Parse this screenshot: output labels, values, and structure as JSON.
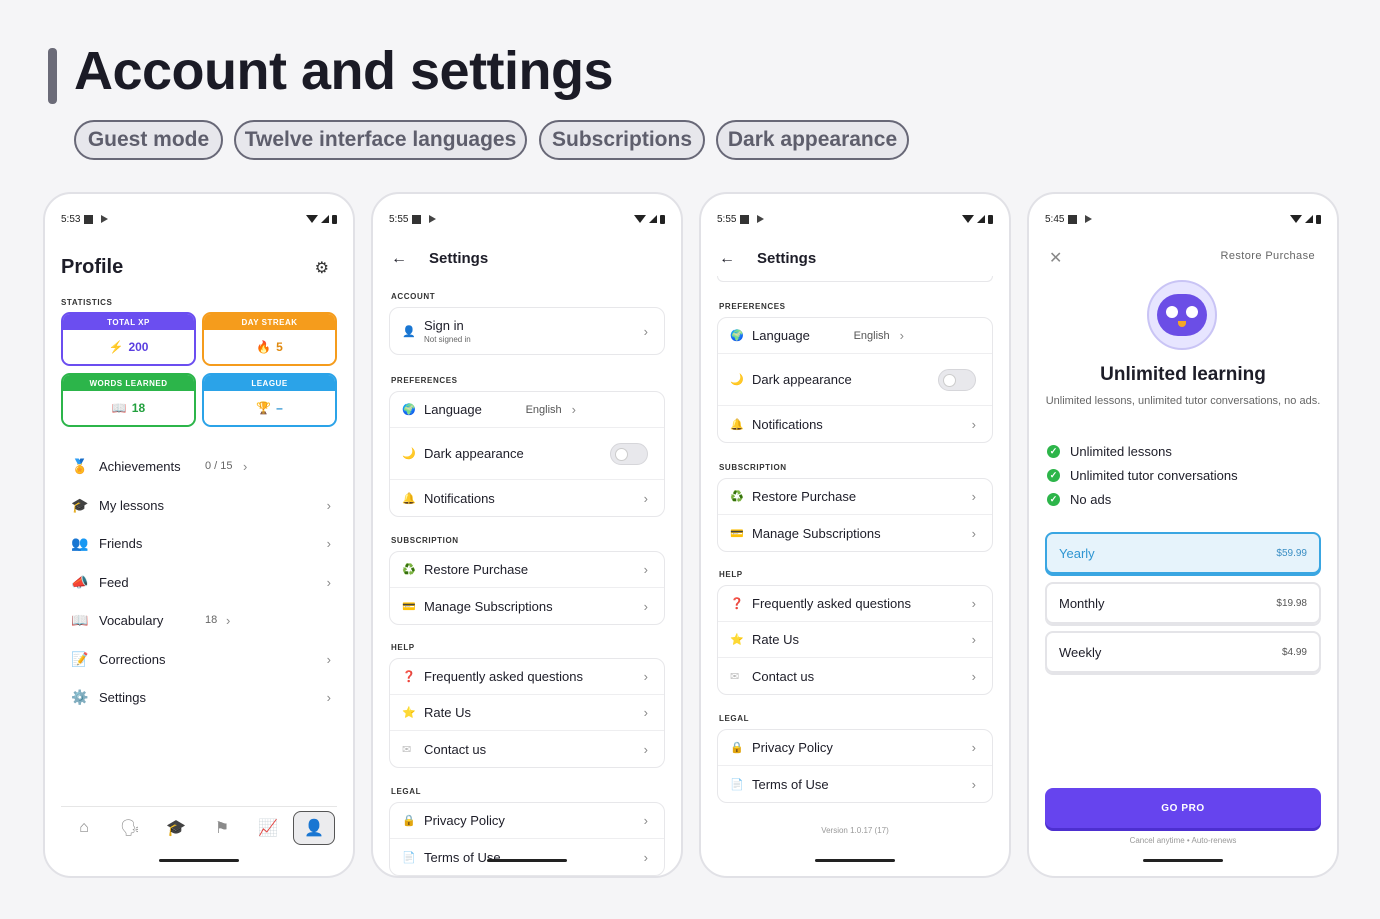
{
  "header": {
    "title": "Account and settings",
    "tags": [
      "Guest mode",
      "Twelve interface languages",
      "Subscriptions",
      "Dark appearance"
    ]
  },
  "profile_screen": {
    "time": "5:53",
    "title": "Profile",
    "statistics_label": "STATISTICS",
    "stats": [
      {
        "label": "TOTAL XP",
        "icon": "⚡",
        "value": "200",
        "color": "#6b4ef0"
      },
      {
        "label": "DAY STREAK",
        "icon": "🔥",
        "value": "5",
        "color": "#f59c1c"
      },
      {
        "label": "WORDS LEARNED",
        "icon": "📖",
        "value": "18",
        "color": "#2cb54a"
      },
      {
        "label": "LEAGUE",
        "icon": "🏆",
        "value": "–",
        "color": "#2ba3e8"
      }
    ],
    "menu": [
      {
        "icon": "🏅",
        "label": "Achievements",
        "count": "0 / 15"
      },
      {
        "icon": "🎓",
        "label": "My lessons",
        "count": ""
      },
      {
        "icon": "👥",
        "label": "Friends",
        "count": ""
      },
      {
        "icon": "📣",
        "label": "Feed",
        "count": ""
      },
      {
        "icon": "📖",
        "label": "Vocabulary",
        "count": "18"
      },
      {
        "icon": "📝",
        "label": "Corrections",
        "count": ""
      },
      {
        "icon": "⚙️",
        "label": "Settings",
        "count": ""
      }
    ]
  },
  "settings_screen": {
    "time": "5:55",
    "title": "Settings",
    "account_label": "ACCOUNT",
    "sign_in": "Sign in",
    "sign_in_sub": "Not signed in",
    "preferences_label": "PREFERENCES",
    "language_label": "Language",
    "language_value": "English",
    "dark_label": "Dark appearance",
    "notifications_label": "Notifications",
    "subscription_label": "SUBSCRIPTION",
    "restore_label": "Restore Purchase",
    "manage_label": "Manage Subscriptions",
    "help_label": "HELP",
    "faq_label": "Frequently asked questions",
    "rate_label": "Rate Us",
    "contact_label": "Contact us",
    "legal_label": "LEGAL",
    "privacy_label": "Privacy Policy",
    "terms_label": "Terms of Use"
  },
  "settings_screen_2": {
    "time": "5:55",
    "version": "Version 1.0.17 (17)"
  },
  "paywall_screen": {
    "time": "5:45",
    "restore": "Restore Purchase",
    "title": "Unlimited learning",
    "subtitle": "Unlimited lessons, unlimited tutor conversations, no ads.",
    "features": [
      "Unlimited lessons",
      "Unlimited tutor conversations",
      "No ads"
    ],
    "plans": [
      {
        "name": "Yearly",
        "price": "$59.99",
        "selected": true
      },
      {
        "name": "Monthly",
        "price": "$19.98",
        "selected": false
      },
      {
        "name": "Weekly",
        "price": "$4.99",
        "selected": false
      }
    ],
    "cta": "GO PRO",
    "fine_print": "Cancel anytime • Auto-renews"
  }
}
